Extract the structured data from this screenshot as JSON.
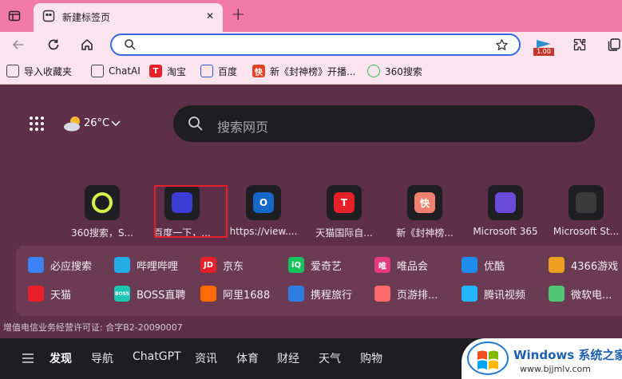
{
  "tab": {
    "title": "新建标签页",
    "close": "✕",
    "new_tab": "+"
  },
  "toolbar": {
    "badge": "1.00"
  },
  "bookmarks": [
    {
      "label": "导入收藏夹",
      "icon": "import-icon",
      "color": "#444444",
      "mark": ""
    },
    {
      "label": "ChatAI",
      "icon": "file-icon",
      "color": "#444444",
      "mark": ""
    },
    {
      "label": "淘宝",
      "icon": "tmall-icon",
      "color": "#e8202a",
      "mark": "T"
    },
    {
      "label": "百度",
      "icon": "baidu-paw-icon",
      "color": "#2d5be3",
      "mark": ""
    },
    {
      "label": "新《封神榜》开播...",
      "icon": "kuai-icon",
      "color": "#e0452a",
      "mark": "快"
    },
    {
      "label": "360搜索",
      "icon": "360-icon",
      "color": "#2fbf4a",
      "mark": ""
    }
  ],
  "weather": {
    "temp": "26°C"
  },
  "search": {
    "placeholder": "搜索网页"
  },
  "tiles": [
    {
      "label": "360搜索，S...",
      "icon": "360-search-icon",
      "bg": "#1f1f23",
      "mark": ""
    },
    {
      "label": "百度一下，...",
      "icon": "baidu-icon",
      "bg": "#3b3dd6",
      "mark": ""
    },
    {
      "label": "https://view....",
      "icon": "outlook-icon",
      "bg": "#1668c8",
      "mark": "O"
    },
    {
      "label": "天猫国际自...",
      "icon": "tmall-intl-icon",
      "bg": "#e8202a",
      "mark": "T"
    },
    {
      "label": "新《封神榜...",
      "icon": "kuai-icon",
      "bg": "#f08070",
      "mark": "快"
    },
    {
      "label": "Microsoft 365",
      "icon": "m365-icon",
      "bg": "#6a4ad8",
      "mark": ""
    },
    {
      "label": "Microsoft St...",
      "icon": "ms-store-icon",
      "bg": "#3a3a3a",
      "mark": ""
    }
  ],
  "quicklinks": [
    {
      "label": "必应搜索",
      "icon": "bing-search-icon",
      "color": "#3b82f6",
      "mark": ""
    },
    {
      "label": "哔哩哔哩",
      "icon": "bilibili-icon",
      "color": "#23ade5",
      "mark": ""
    },
    {
      "label": "京东",
      "icon": "jd-icon",
      "color": "#e8202a",
      "mark": "JD"
    },
    {
      "label": "爱奇艺",
      "icon": "iqiyi-icon",
      "color": "#14c25b",
      "mark": "iQ"
    },
    {
      "label": "唯品会",
      "icon": "vip-icon",
      "color": "#e4397a",
      "mark": "唯"
    },
    {
      "label": "优酷",
      "icon": "youku-icon",
      "color": "#1e8cf0",
      "mark": ""
    },
    {
      "label": "4366游戏",
      "icon": "4366-icon",
      "color": "#f0a020",
      "mark": ""
    },
    {
      "label": "天猫",
      "icon": "tmall-cat-icon",
      "color": "#e8202a",
      "mark": ""
    },
    {
      "label": "BOSS直聘",
      "icon": "boss-icon",
      "color": "#1cc6b4",
      "mark": "BOSS"
    },
    {
      "label": "阿里1688",
      "icon": "1688-icon",
      "color": "#ff6a00",
      "mark": ""
    },
    {
      "label": "携程旅行",
      "icon": "ctrip-icon",
      "color": "#2f7de1",
      "mark": ""
    },
    {
      "label": "页游排...",
      "icon": "game-pad-icon",
      "color": "#ff6a6a",
      "mark": ""
    },
    {
      "label": "腾讯视频",
      "icon": "tencent-video-icon",
      "color": "#24b6ff",
      "mark": ""
    },
    {
      "label": "微软电...",
      "icon": "ms-pc-icon",
      "color": "#50c878",
      "mark": ""
    }
  ],
  "license": "增值电信业务经营许可证: 合字B2-20090007",
  "bottom_nav": [
    "发现",
    "导航",
    "ChatGPT",
    "资讯",
    "体育",
    "财经",
    "天气",
    "购物"
  ],
  "watermark": {
    "title": "Windows 系统之家",
    "url": "www.bjjmlv.com"
  }
}
